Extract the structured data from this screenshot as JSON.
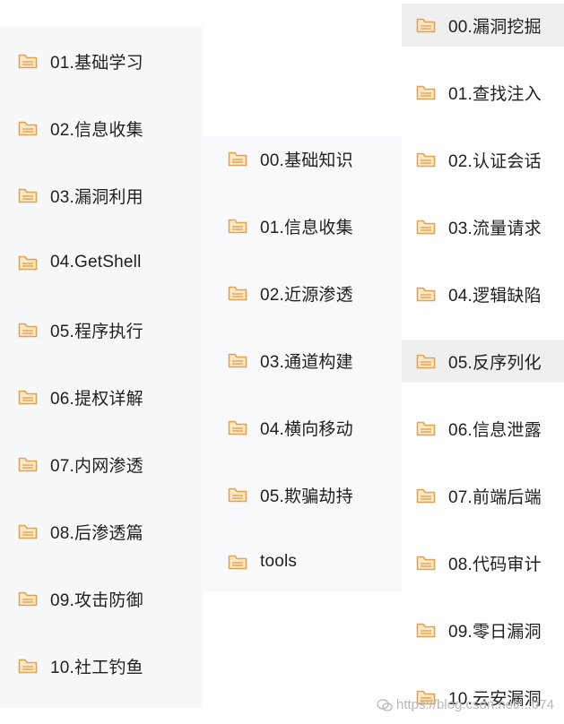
{
  "icon_name": "folder-icon",
  "colors": {
    "folder_outline": "#e3a24f",
    "folder_fill": "#fbe8c9",
    "text": "#1f1f1f"
  },
  "column1": {
    "items": [
      {
        "label": "01.基础学习"
      },
      {
        "label": "02.信息收集"
      },
      {
        "label": "03.漏洞利用"
      },
      {
        "label": "04.GetShell"
      },
      {
        "label": "05.程序执行"
      },
      {
        "label": "06.提权详解"
      },
      {
        "label": "07.内网渗透"
      },
      {
        "label": "08.后渗透篇"
      },
      {
        "label": "09.攻击防御"
      },
      {
        "label": "10.社工钓鱼"
      }
    ]
  },
  "column2": {
    "items": [
      {
        "label": "00.基础知识"
      },
      {
        "label": "01.信息收集"
      },
      {
        "label": "02.近源渗透"
      },
      {
        "label": "03.通道构建"
      },
      {
        "label": "04.横向移动"
      },
      {
        "label": "05.欺骗劫持"
      },
      {
        "label": "tools"
      }
    ]
  },
  "column3": {
    "items": [
      {
        "label": "00.漏洞挖掘",
        "highlighted": true
      },
      {
        "label": "01.查找注入"
      },
      {
        "label": "02.认证会话"
      },
      {
        "label": "03.流量请求"
      },
      {
        "label": "04.逻辑缺陷"
      },
      {
        "label": "05.反序列化",
        "highlighted": true
      },
      {
        "label": "06.信息泄露"
      },
      {
        "label": "07.前端后端"
      },
      {
        "label": "08.代码审计"
      },
      {
        "label": "09.零日漏洞"
      },
      {
        "label": "10.云安漏洞"
      }
    ]
  },
  "watermark": {
    "text": "https://blog.csdn.net/...074"
  }
}
